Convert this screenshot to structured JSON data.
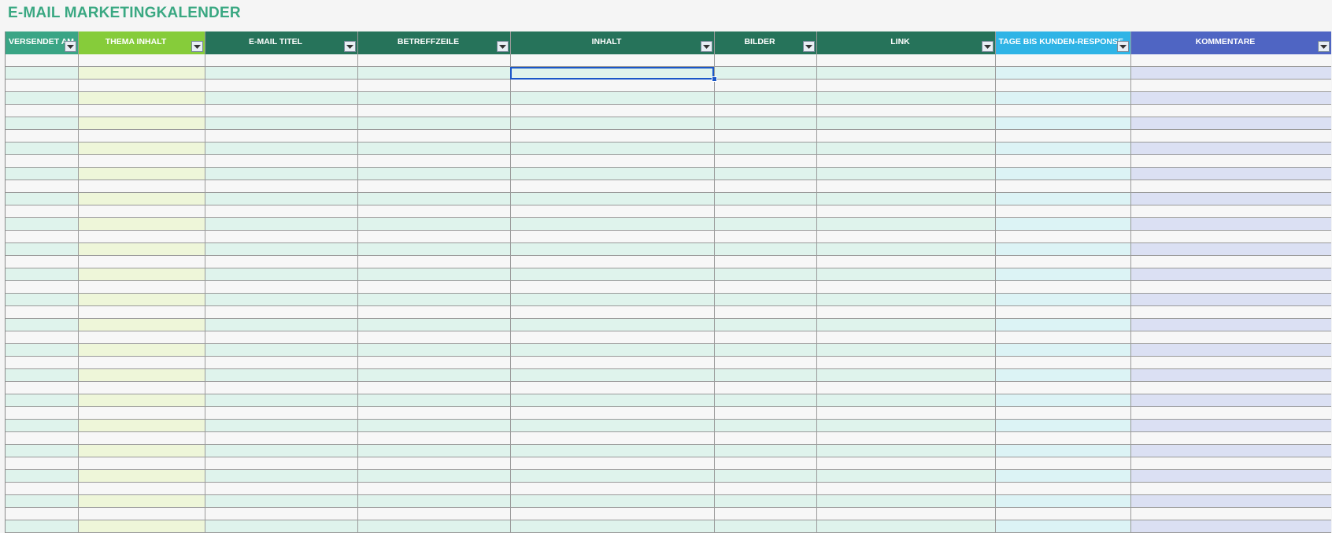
{
  "sheet": {
    "title": "E-MAIL MARKETINGKALENDER"
  },
  "columns": [
    {
      "label": "VERSENDET AM",
      "color": "#3aa585",
      "tint": "c-mint"
    },
    {
      "label": "THEMA INHALT",
      "color": "#86cc3a",
      "tint": "c-lime"
    },
    {
      "label": "E-MAIL TITEL",
      "color": "#26735a",
      "tint": "c-mint"
    },
    {
      "label": "BETREFFZEILE",
      "color": "#26735a",
      "tint": "c-mint"
    },
    {
      "label": "INHALT",
      "color": "#26735a",
      "tint": "c-mint"
    },
    {
      "label": "BILDER",
      "color": "#26735a",
      "tint": "c-mint"
    },
    {
      "label": "LINK",
      "color": "#26735a",
      "tint": "c-mint"
    },
    {
      "label": "TAGE BIS KUNDEN-RESPONSE",
      "color": "#2fb4e6",
      "tint": "c-sky"
    },
    {
      "label": "KOMMENTARE",
      "color": "#4f65c3",
      "tint": "c-lav"
    }
  ],
  "row_count": 38,
  "selected_cell": {
    "row": 1,
    "col": 4
  },
  "icons": {
    "filter": "filter-dropdown-icon"
  }
}
